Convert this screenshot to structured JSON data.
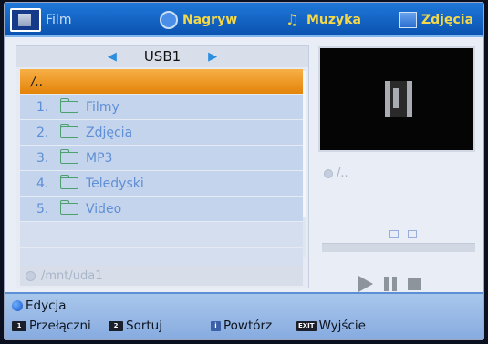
{
  "tabs": [
    {
      "label": "Film",
      "icon": "film-icon",
      "active": true
    },
    {
      "label": "Nagryw",
      "icon": "record-icon",
      "active": false
    },
    {
      "label": "Muzyka",
      "icon": "music-icon",
      "active": false
    },
    {
      "label": "Zdjęcia",
      "icon": "photo-icon",
      "active": false
    }
  ],
  "browser": {
    "device": "USB1",
    "parent_entry": "/..",
    "items": [
      {
        "index": "1.",
        "name": "Filmy"
      },
      {
        "index": "2.",
        "name": "Zdjęcia"
      },
      {
        "index": "3.",
        "name": "MP3"
      },
      {
        "index": "4.",
        "name": "Teledyski"
      },
      {
        "index": "5.",
        "name": "Video"
      }
    ],
    "current_path": "/mnt/uda1"
  },
  "preview": {
    "path": "/.."
  },
  "footer": {
    "edit_label": "Edycja",
    "switch_key": "1",
    "switch_label": "Przełączni",
    "sort_key": "2",
    "sort_label": "Sortuj",
    "repeat_key": "i",
    "repeat_label": "Powtórz",
    "exit_key": "EXIT",
    "exit_label": "Wyjście"
  },
  "colors": {
    "topbar": "#0a52b0",
    "tab_text": "#f4d84a",
    "selected_row": "#e4830a",
    "folder": "#4ba06c",
    "row_text": "#5f8fd6"
  }
}
